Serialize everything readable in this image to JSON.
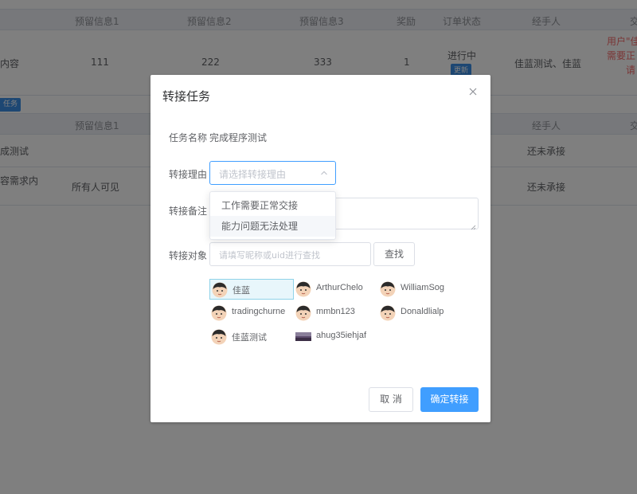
{
  "table1": {
    "headers": [
      "预留信息1",
      "预留信息2",
      "预留信息3",
      "奖励",
      "订单状态",
      "经手人",
      "交"
    ],
    "row": {
      "content": "内容",
      "info1": "111",
      "info2": "222",
      "info3": "333",
      "reward": "1",
      "status": "进行中",
      "update_label": "更新",
      "handler": "佳蓝测试、佳蓝",
      "notice_lines": [
        "用户\"佳",
        "需要正",
        "请"
      ]
    }
  },
  "task_button_label": "任务",
  "table2": {
    "headers": [
      "预留信息1",
      "经手人",
      "交"
    ],
    "rows": [
      {
        "col1": "成测试",
        "info1": "",
        "handler": "还未承接"
      },
      {
        "col1": "容需求内",
        "info1": "所有人可见",
        "handler": "还未承接"
      }
    ]
  },
  "dialog": {
    "title": "转接任务",
    "close_icon": "close-icon",
    "task_name_label": "任务名称",
    "task_name_value": "完成程序测试",
    "reason_label": "转接理由",
    "reason_placeholder": "请选择转接理由",
    "reason_options": [
      "工作需要正常交接",
      "能力问题无法处理"
    ],
    "note_label": "转接备注",
    "target_label": "转接对象",
    "search_placeholder": "请填写昵称或uid进行查找",
    "find_label": "查找",
    "users": [
      {
        "name": "佳蓝",
        "selected": true
      },
      {
        "name": "ArthurChelo",
        "selected": false
      },
      {
        "name": "WilliamSog",
        "selected": false
      },
      {
        "name": "tradingchurne",
        "selected": false
      },
      {
        "name": "mmbn123",
        "selected": false
      },
      {
        "name": "Donaldlialp",
        "selected": false
      },
      {
        "name": "佳蓝测试",
        "selected": false
      },
      {
        "name": "ahug35iehjaf",
        "selected": false
      }
    ],
    "cancel_label": "取 消",
    "confirm_label": "确定转接"
  },
  "colors": {
    "primary": "#409eff",
    "danger": "#f56c6c",
    "selected_bg": "#e8f6fb"
  }
}
